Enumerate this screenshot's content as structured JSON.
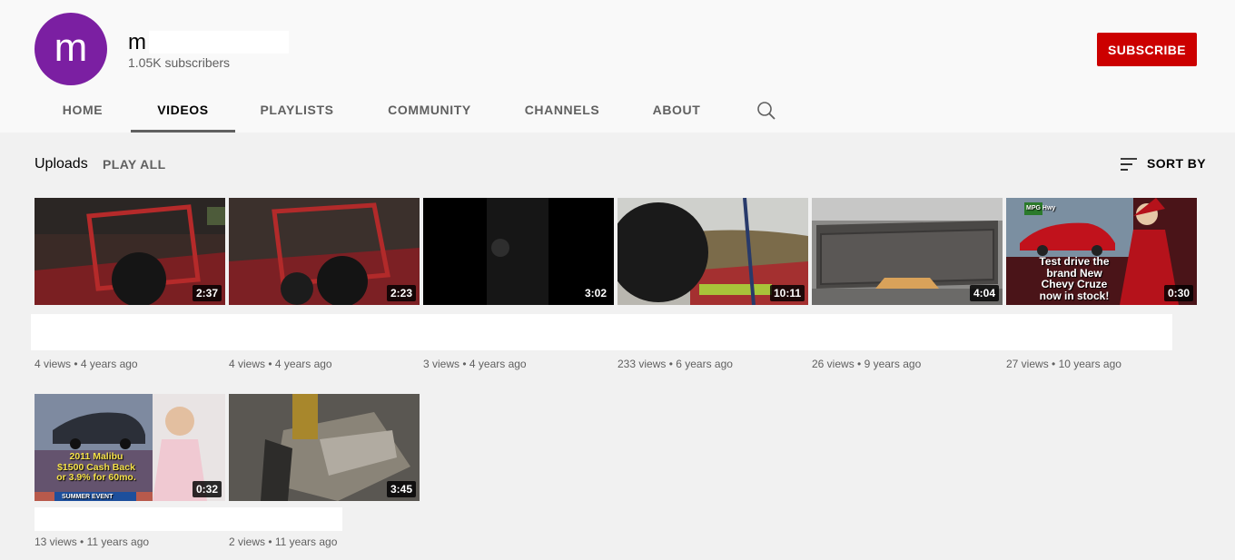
{
  "channel": {
    "avatar_letter": "m",
    "name": "m",
    "subscribers": "1.05K subscribers",
    "subscribe_label": "SUBSCRIBE"
  },
  "tabs": [
    {
      "label": "HOME",
      "active": false
    },
    {
      "label": "VIDEOS",
      "active": true
    },
    {
      "label": "PLAYLISTS",
      "active": false
    },
    {
      "label": "COMMUNITY",
      "active": false
    },
    {
      "label": "CHANNELS",
      "active": false
    },
    {
      "label": "ABOUT",
      "active": false
    }
  ],
  "section": {
    "title": "Uploads",
    "play_all": "PLAY ALL",
    "sort_by": "SORT BY"
  },
  "videos": [
    {
      "duration": "2:37",
      "views": "4 views",
      "age": "4 years ago"
    },
    {
      "duration": "2:23",
      "views": "4 views",
      "age": "4 years ago"
    },
    {
      "duration": "3:02",
      "views": "3 views",
      "age": "4 years ago"
    },
    {
      "duration": "10:11",
      "views": "233 views",
      "age": "6 years ago"
    },
    {
      "duration": "4:04",
      "views": "26 views",
      "age": "9 years ago"
    },
    {
      "duration": "0:30",
      "views": "27 views",
      "age": "10 years ago",
      "overlay": [
        "Test drive the",
        "brand New",
        "Chevy Cruze",
        "now in stock!"
      ],
      "badge": "MPG Hwy"
    },
    {
      "duration": "0:32",
      "views": "13 views",
      "age": "11 years ago",
      "overlay": [
        "2011 Malibu",
        "$1500 Cash Back",
        "or 3.9% for 60mo."
      ],
      "banner": "SUMMER EVENT"
    },
    {
      "duration": "3:45",
      "views": "2 views",
      "age": "11 years ago"
    }
  ],
  "colors": {
    "subscribe": "#cc0000",
    "avatar": "#7b1fa2"
  }
}
